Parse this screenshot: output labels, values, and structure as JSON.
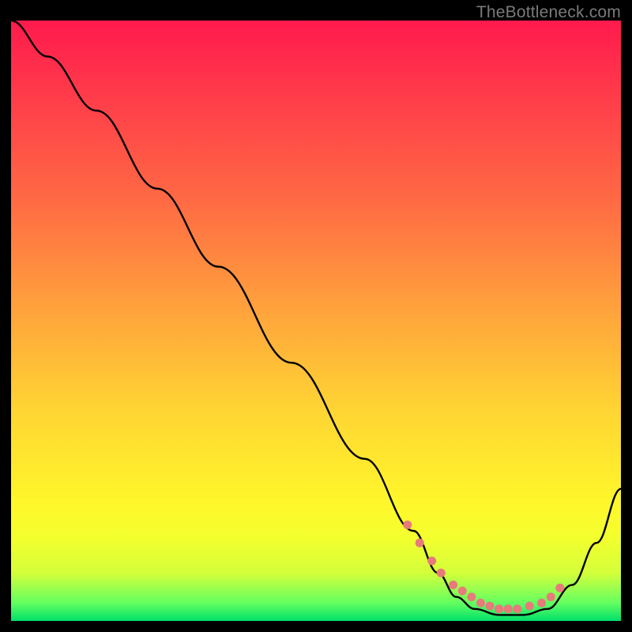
{
  "watermark": {
    "text": "TheBottleneck.com"
  },
  "colors": {
    "curve_stroke": "#000000",
    "dot_fill": "#e77a7a",
    "gradient_top": "#ff1a4d",
    "gradient_bottom": "#00e06a"
  },
  "chart_data": {
    "type": "line",
    "title": "",
    "xlabel": "",
    "ylabel": "",
    "xlim": [
      0,
      100
    ],
    "ylim": [
      0,
      100
    ],
    "grid": false,
    "series": [
      {
        "name": "curve",
        "x": [
          0,
          6,
          14,
          24,
          34,
          46,
          58,
          66,
          70,
          73,
          76,
          80,
          84,
          88,
          92,
          96,
          100
        ],
        "y": [
          100,
          94,
          85,
          72,
          59,
          43,
          27,
          15,
          8,
          4,
          2,
          1,
          1,
          2,
          6,
          13,
          22
        ]
      }
    ],
    "annotations": {
      "valley_dots_x": [
        65,
        67,
        69,
        70.5,
        72.5,
        74,
        75.5,
        77,
        78.5,
        80,
        81.5,
        83,
        85,
        87,
        88.5,
        90
      ],
      "valley_dots_y": [
        16,
        13,
        10,
        8,
        6,
        5,
        4,
        3,
        2.5,
        2,
        2,
        2,
        2.5,
        3,
        4,
        5.5
      ]
    }
  }
}
